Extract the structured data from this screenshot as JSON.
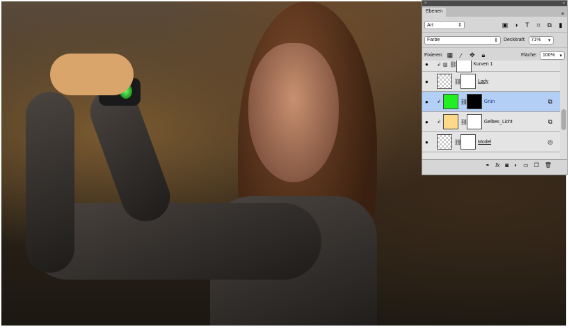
{
  "panel": {
    "title": "Ebenen",
    "filter": "Art",
    "blend_mode": "Farbe",
    "opacity_label": "Deckkraft:",
    "opacity": "71%",
    "lock_label": "Fixieren:",
    "fill_label": "Fläche:",
    "fill": "100%"
  },
  "layers": [
    {
      "name": "Kurven 1",
      "active": false
    },
    {
      "name": "Lady",
      "active": false
    },
    {
      "name": "Grün",
      "active": true,
      "color": "#22ee22"
    },
    {
      "name": "Gelbes_Licht",
      "active": false,
      "color": "#fdd98a"
    },
    {
      "name": "Model",
      "active": false
    }
  ],
  "icons": {
    "collapse": "«",
    "menu": "≡",
    "fx": "fx"
  }
}
